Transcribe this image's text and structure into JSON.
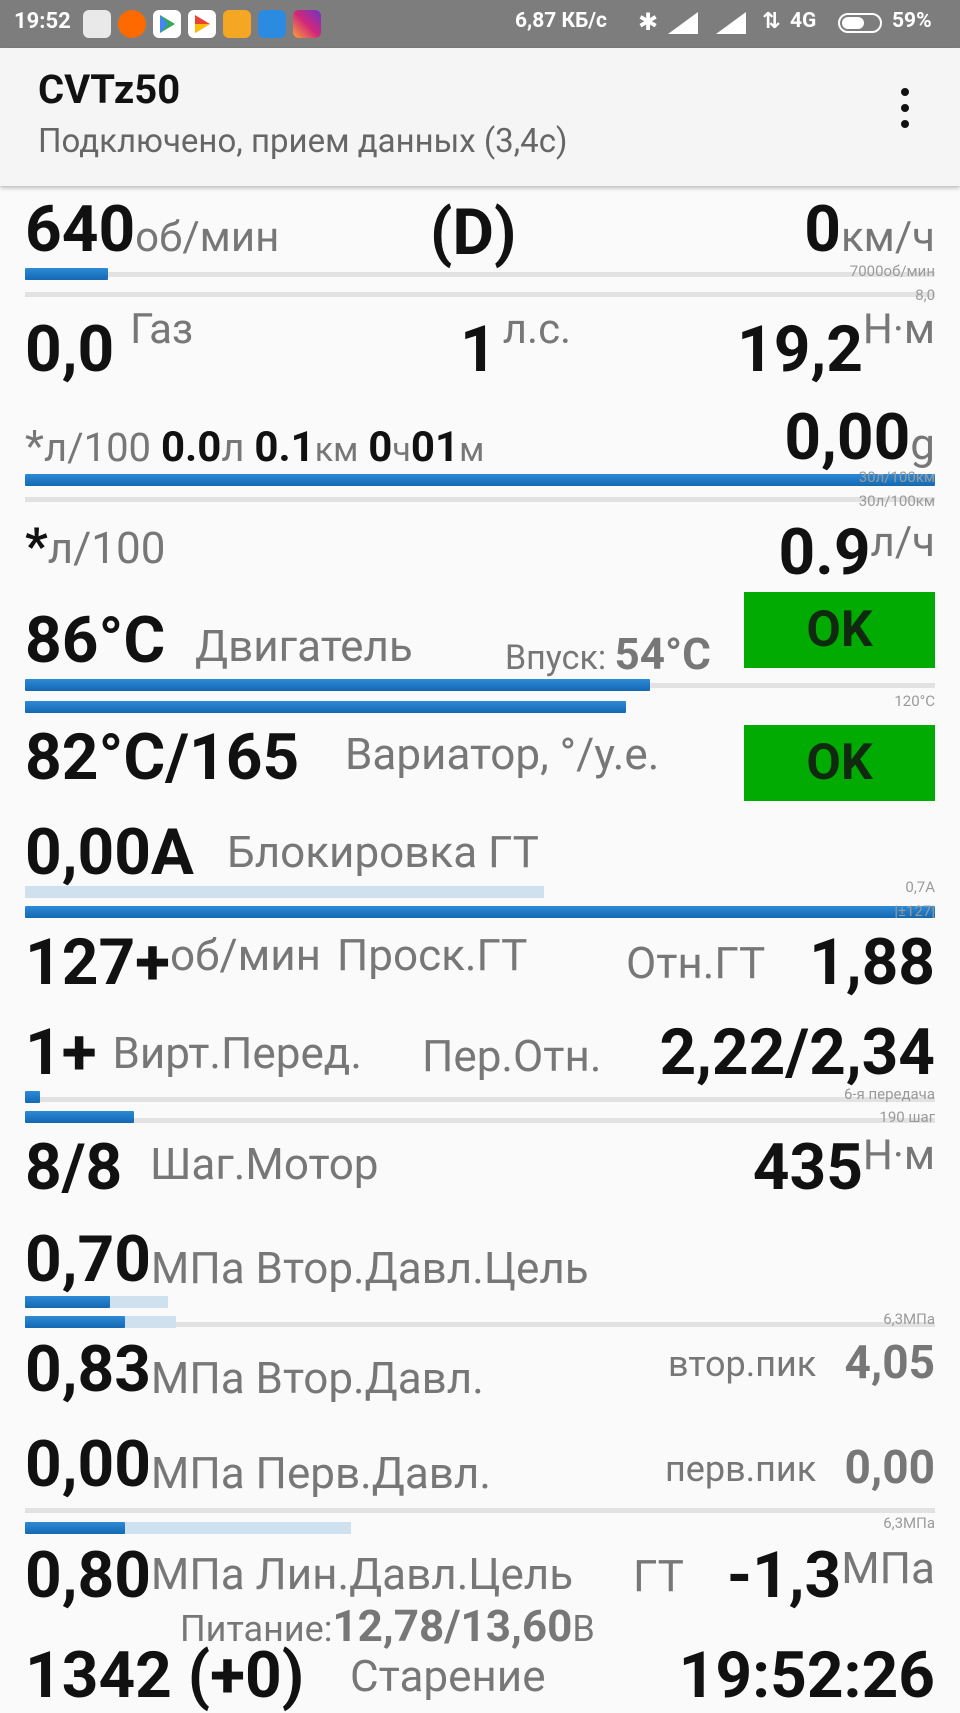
{
  "status_bar": {
    "time": "19:52",
    "speed": "6,87 КБ/с",
    "network": "4G",
    "battery": "59%"
  },
  "app_bar": {
    "title": "CVTz50",
    "subtitle": "Подключено, прием данных (3,4с)"
  },
  "row_rpm": {
    "rpm": "640",
    "rpm_unit": "об/мин",
    "gear_mode": "(D)",
    "speed": "0",
    "speed_unit": "км/ч",
    "scale_label": "7000об/мин",
    "scale_label2": "8,0",
    "rpm_fraction": 0.091
  },
  "row_throttle": {
    "throttle": "0,0",
    "throttle_label": "Газ",
    "power": "1",
    "power_unit": "л.с.",
    "torque": "19,2",
    "torque_unit": "Н·м"
  },
  "row_trip": {
    "prefix": "*",
    "cons_unit": "л/100",
    "fuel": "0.0",
    "fuel_unit": "л",
    "distance": "0.1",
    "distance_unit": "км",
    "hours": "0",
    "hours_unit": "ч",
    "minutes": "01",
    "minutes_unit": "м",
    "g_value": "0,00",
    "g_unit": "g",
    "scale_label": "30л/100км",
    "scale_label2": "30л/100км"
  },
  "row_consumption": {
    "prefix": "*",
    "unit": "л/100",
    "hourly": "0.9",
    "hourly_unit": "л/ч"
  },
  "row_engine": {
    "temp": "86°C",
    "label": "Двигатель",
    "intake_label": "Впуск:",
    "intake_temp": "54°C",
    "status": "OK",
    "scale_label": "120°C",
    "temp_fraction": 0.687,
    "intake_fraction": 0.66
  },
  "row_cvt": {
    "temp": "82°C/165",
    "label": "Вариатор, °/у.е.",
    "status": "OK"
  },
  "row_lockup": {
    "current": "0,00A",
    "label": "Блокировка ГТ",
    "scale_label": "0,7A",
    "scale_label2": "|±127|",
    "current_fraction": 0.57,
    "slip_fraction": 1.0
  },
  "row_slip": {
    "slip": "127+",
    "slip_unit": "об/мин",
    "label": "Проск.ГТ",
    "ratio_label": "Отн.ГТ",
    "ratio": "1,88"
  },
  "row_gear": {
    "gear": "1+",
    "label": "Вирт.Перед.",
    "ratio_label": "Пер.Отн.",
    "ratio": "2,22/2,34",
    "scale_label": "6-я передача",
    "scale_label2": "190 шаг",
    "gear_fraction": 0.017,
    "step_fraction": 0.12
  },
  "row_stepper": {
    "steps": "8/8",
    "label": "Шаг.Мотор",
    "torque": "435",
    "torque_unit": "Н·м"
  },
  "row_sec_target": {
    "value": "0,70",
    "label": "МПа Втор.Давл.Цель",
    "scale_label": "6,3МПа",
    "target_fraction": 0.093,
    "target_fraction_light": 0.157,
    "actual_fraction": 0.11,
    "actual_fraction_light": 0.166
  },
  "row_sec": {
    "value": "0,83",
    "label": "МПа Втор.Давл.",
    "peak_label": "втор.пик",
    "peak": "4,05"
  },
  "row_prim": {
    "value": "0,00",
    "label": "МПа Перв.Давл.",
    "peak_label": "перв.пик",
    "peak": "0,00",
    "scale_label": "6,3МПа",
    "fraction": 0.11,
    "fraction_light": 0.358
  },
  "row_line": {
    "value": "0,80",
    "label": "МПа Лин.Давл.Цель",
    "gt_label": "ГТ",
    "gt_value": "-1,3",
    "gt_unit": "МПа",
    "power_label": "Питание:",
    "power_value": "12,78/13,60",
    "power_unit": "В"
  },
  "row_aging": {
    "value": "1342 (+0)",
    "label": "Старение",
    "clock": "19:52:26"
  }
}
